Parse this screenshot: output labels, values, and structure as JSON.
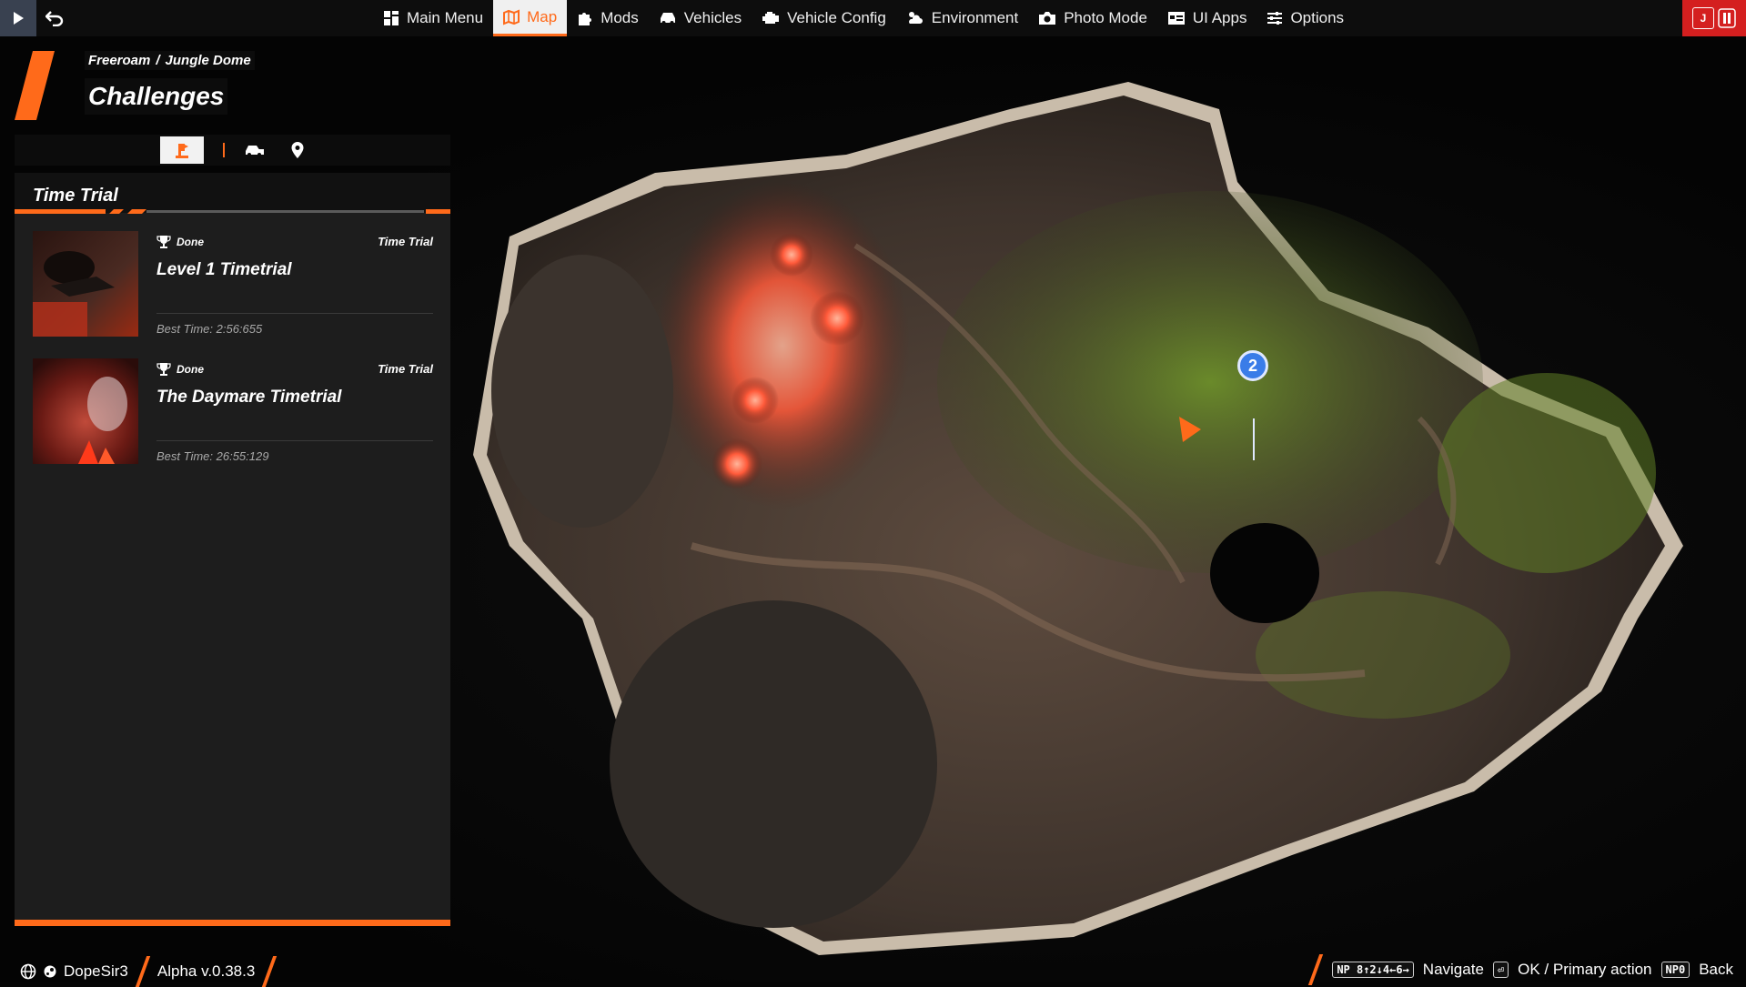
{
  "topbar": {
    "menu": [
      {
        "label": "Main Menu",
        "icon": "main-menu-icon"
      },
      {
        "label": "Map",
        "icon": "map-icon",
        "active": true
      },
      {
        "label": "Mods",
        "icon": "puzzle-icon"
      },
      {
        "label": "Vehicles",
        "icon": "car-icon"
      },
      {
        "label": "Vehicle Config",
        "icon": "engine-icon"
      },
      {
        "label": "Environment",
        "icon": "weather-icon"
      },
      {
        "label": "Photo Mode",
        "icon": "camera-icon"
      },
      {
        "label": "UI Apps",
        "icon": "ui-apps-icon"
      },
      {
        "label": "Options",
        "icon": "sliders-icon"
      }
    ],
    "pause_key": "J"
  },
  "header": {
    "breadcrumb_1": "Freeroam",
    "breadcrumb_sep": "/",
    "breadcrumb_2": "Jungle Dome",
    "title": "Challenges"
  },
  "tabs": [
    {
      "icon": "challenge-icon",
      "active": true
    },
    {
      "icon": "vehicle-delivery-icon",
      "active": false
    },
    {
      "icon": "location-pin-icon",
      "active": false
    }
  ],
  "section": {
    "title": "Time Trial"
  },
  "challenges": [
    {
      "status": "Done",
      "type": "Time Trial",
      "name": "Level 1 Timetrial",
      "best_time": "Best Time: 2:56:655"
    },
    {
      "status": "Done",
      "type": "Time Trial",
      "name": "The Daymare Timetrial",
      "best_time": "Best Time: 26:55:129"
    }
  ],
  "map": {
    "marker_number": "2"
  },
  "bottombar": {
    "username": "DopeSir3",
    "version": "Alpha v.0.38.3",
    "hints": [
      {
        "key": "NP 8↑2↓4←6→",
        "label": "Navigate"
      },
      {
        "key": "⏎",
        "label": "OK / Primary action"
      },
      {
        "key": "NP0",
        "label": "Back"
      }
    ]
  },
  "colors": {
    "accent": "#ff6a1a",
    "panel": "#1d1d1d",
    "pause": "#d41f1f"
  }
}
